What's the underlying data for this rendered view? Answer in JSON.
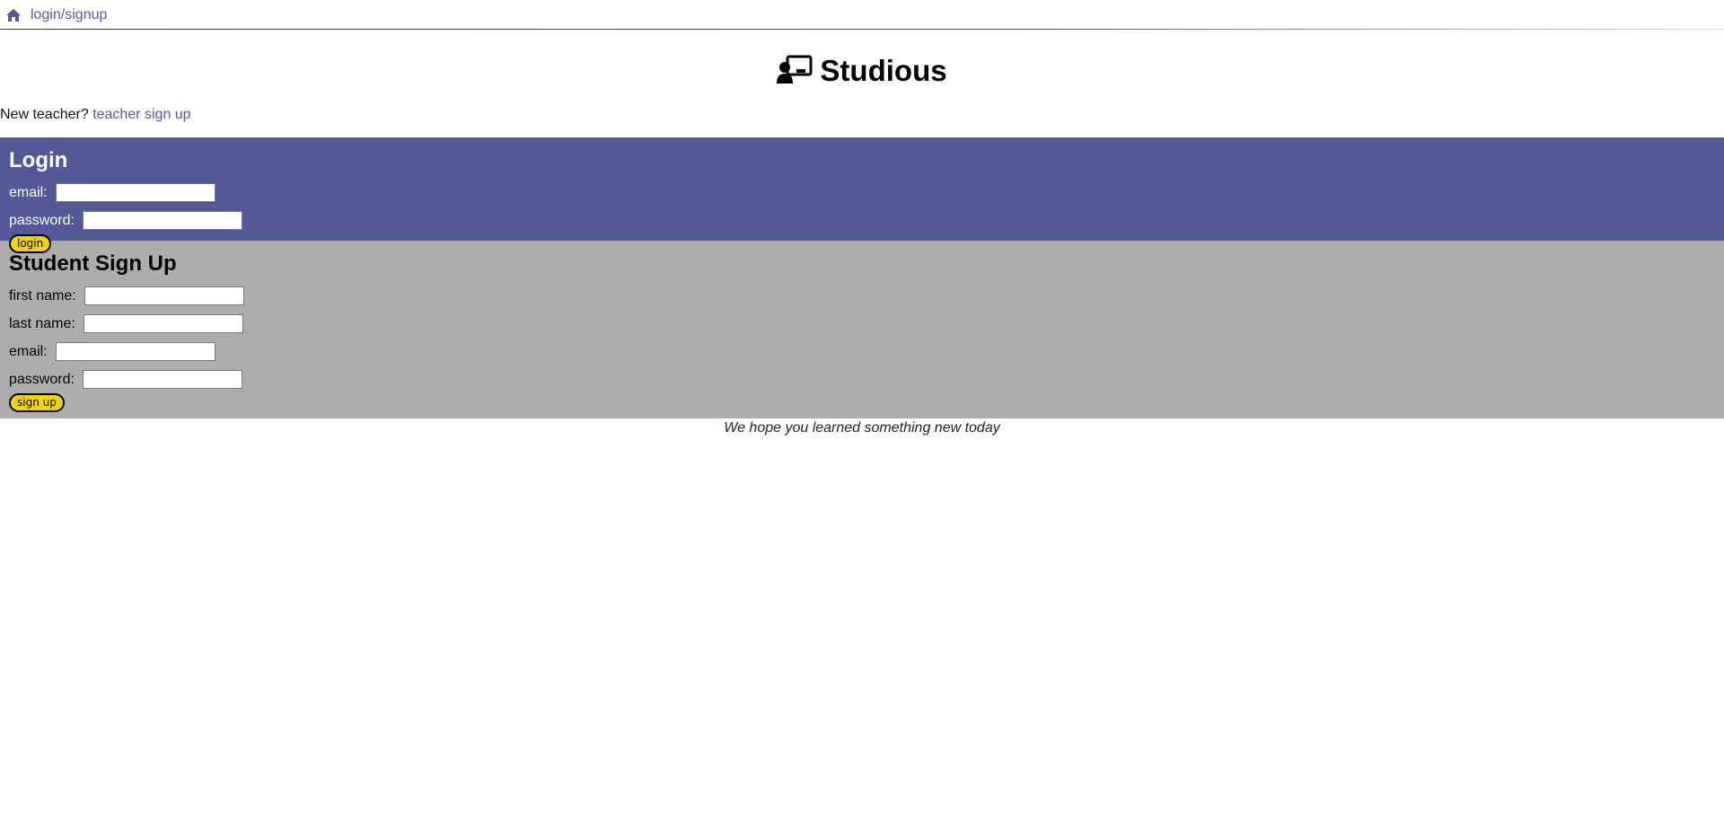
{
  "topnav": {
    "home_icon": "home-icon",
    "crumb": "login/signup",
    "link_color": "#525a9a"
  },
  "brand": {
    "icon": "chalkboard-teacher-icon",
    "title": "Studious"
  },
  "newteacher": {
    "prefix": "New teacher?",
    "link": "teacher sign up"
  },
  "login": {
    "heading": "Login",
    "email_label": "email:",
    "email_value": "",
    "password_label": "password:",
    "password_value": "",
    "button": "login",
    "bg": "#535899"
  },
  "signup": {
    "heading": "Student Sign Up",
    "first_label": "first name:",
    "first_value": "",
    "last_label": "last name:",
    "last_value": "",
    "email_label": "email:",
    "email_value": "",
    "password_label": "password:",
    "password_value": "",
    "button": "sign up",
    "bg": "#adadad"
  },
  "button_color": "#f1d400",
  "footer": "We hope you learned something new today"
}
